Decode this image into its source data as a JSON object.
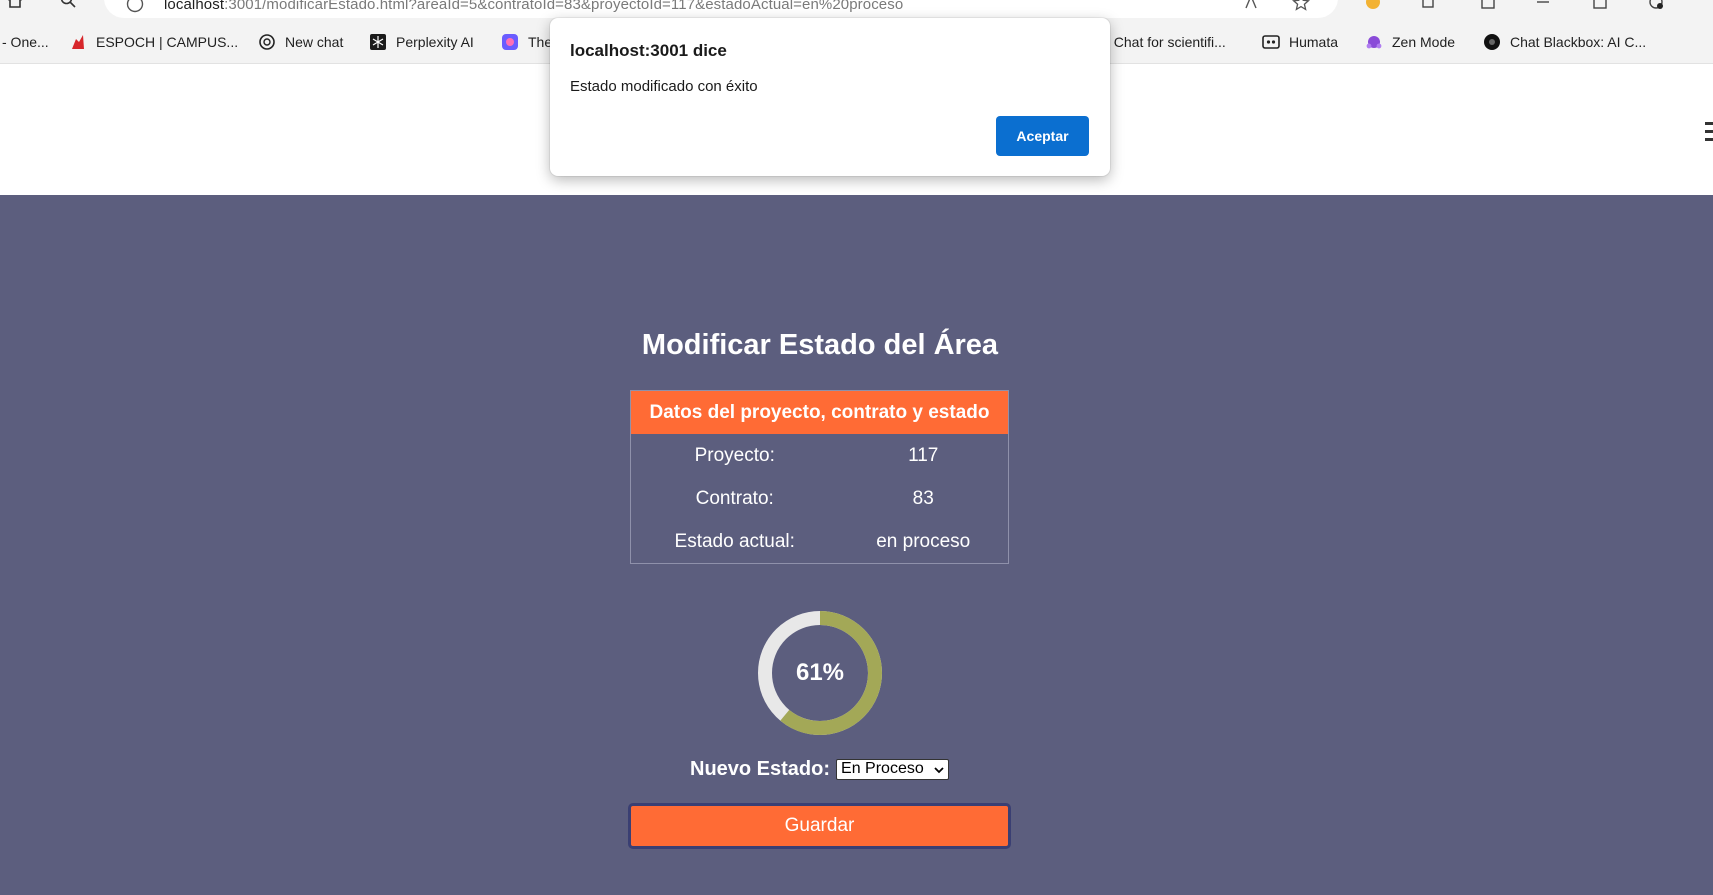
{
  "browser": {
    "url_host": "localhost",
    "url_rest": ":3001/modificarEstado.html?areaId=5&contratoId=83&proyectoId=117&estadoActual=en%20proceso",
    "bookmarks": [
      {
        "label": "- One...",
        "icon": "onedrive-icon"
      },
      {
        "label": "ESPOCH | CAMPUS...",
        "icon": "espoch-icon"
      },
      {
        "label": "New chat",
        "icon": "openai-icon"
      },
      {
        "label": "Perplexity AI",
        "icon": "perplexity-icon"
      },
      {
        "label": "The",
        "icon": "app-icon"
      },
      {
        "label": "I Chat for scientifi...",
        "icon": ""
      },
      {
        "label": "Humata",
        "icon": "humata-icon"
      },
      {
        "label": "Zen Mode",
        "icon": "zen-icon"
      },
      {
        "label": "Chat Blackbox: AI C...",
        "icon": "blackbox-icon"
      }
    ]
  },
  "dialog": {
    "origin": "localhost:3001 dice",
    "message": "Estado modificado con éxito",
    "ok_label": "Aceptar"
  },
  "page": {
    "title": "Modificar Estado del Área",
    "table": {
      "header": "Datos del proyecto, contrato y estado",
      "rows": [
        {
          "label": "Proyecto:",
          "value": "117"
        },
        {
          "label": "Contrato:",
          "value": "83"
        },
        {
          "label": "Estado actual:",
          "value": "en proceso"
        }
      ]
    },
    "progress": {
      "percent_label": "61%",
      "value": 0.61,
      "fill_color": "#a3a857",
      "track_color": "#e8e8e8"
    },
    "nuevo_estado_label": "Nuevo Estado:",
    "nuevo_estado_selected": "En Proceso",
    "save_label": "Guardar"
  },
  "colors": {
    "page_bg": "#5c5e7e",
    "accent": "#ff6b35",
    "dialog_button": "#0b6fd0"
  }
}
